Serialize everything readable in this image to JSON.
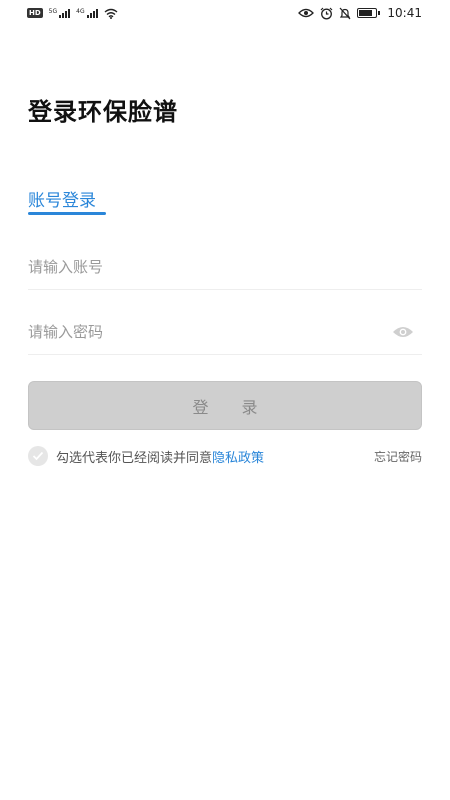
{
  "status_bar": {
    "hd": "HD",
    "net1": "5G",
    "net2": "4G",
    "time": "10:41"
  },
  "page": {
    "title": "登录环保脸谱",
    "tab_label": "账号登录"
  },
  "form": {
    "account_placeholder": "请输入账号",
    "password_placeholder": "请输入密码",
    "login_label": "登 录"
  },
  "agreement": {
    "text": "勾选代表你已经阅读并同意",
    "policy_link": "隐私政策",
    "forgot_password": "忘记密码"
  },
  "colors": {
    "accent": "#2a86d9",
    "button_disabled": "#cfcfcf"
  }
}
